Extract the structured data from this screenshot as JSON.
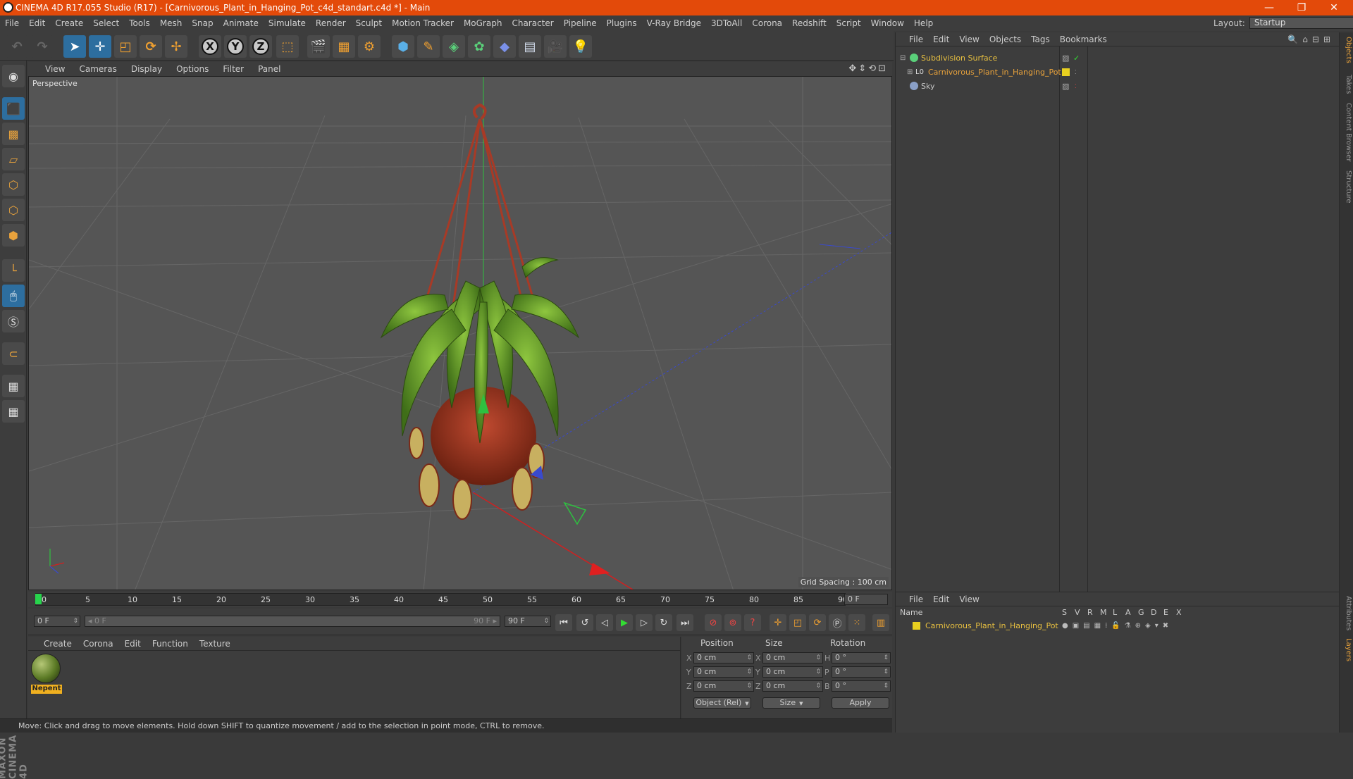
{
  "window": {
    "title": "CINEMA 4D R17.055 Studio (R17) - [Carnivorous_Plant_in_Hanging_Pot_c4d_standart.c4d *] - Main",
    "controls": [
      "—",
      "❐",
      "✕"
    ]
  },
  "menubar": {
    "items": [
      "File",
      "Edit",
      "Create",
      "Select",
      "Tools",
      "Mesh",
      "Snap",
      "Animate",
      "Simulate",
      "Render",
      "Sculpt",
      "Motion Tracker",
      "MoGraph",
      "Character",
      "Pipeline",
      "Plugins",
      "V-Ray Bridge",
      "3DToAll",
      "Corona",
      "Redshift",
      "Script",
      "Window",
      "Help"
    ],
    "layout_label": "Layout:",
    "layout_value": "Startup"
  },
  "toolbar": {
    "axis_x": "X",
    "axis_y": "Y",
    "axis_z": "Z"
  },
  "viewport": {
    "menu": [
      "View",
      "Cameras",
      "Display",
      "Options",
      "Filter",
      "Panel"
    ],
    "label": "Perspective",
    "grid_spacing": "Grid Spacing : 100 cm",
    "nav_icons": "✥⇕⟲⊡"
  },
  "timeline": {
    "ticks": [
      "0",
      "5",
      "10",
      "15",
      "20",
      "25",
      "30",
      "35",
      "40",
      "45",
      "50",
      "55",
      "60",
      "65",
      "70",
      "75",
      "80",
      "85",
      "90"
    ],
    "current_frame": "0 F"
  },
  "transport": {
    "start_frame": "0 F",
    "range_start": "◂ 0 F",
    "range_end": "90 F ▸",
    "end_frame": "90 F"
  },
  "material_panel": {
    "menu": [
      "Create",
      "Corona",
      "Edit",
      "Function",
      "Texture"
    ],
    "material_name": "Nepent"
  },
  "coordinates": {
    "headers": [
      "Position",
      "Size",
      "Rotation"
    ],
    "rows": [
      {
        "axis": "X",
        "pos": "0 cm",
        "size_axis": "X",
        "size": "0 cm",
        "rot_axis": "H",
        "rot": "0 °"
      },
      {
        "axis": "Y",
        "pos": "0 cm",
        "size_axis": "Y",
        "size": "0 cm",
        "rot_axis": "P",
        "rot": "0 °"
      },
      {
        "axis": "Z",
        "pos": "0 cm",
        "size_axis": "Z",
        "size": "0 cm",
        "rot_axis": "B",
        "rot": "0 °"
      }
    ],
    "mode_dropdown": "Object (Rel)",
    "size_dropdown": "Size",
    "apply": "Apply"
  },
  "status": "Move: Click and drag to move elements. Hold down SHIFT to quantize movement / add to the selection in point mode, CTRL to remove.",
  "objects_panel": {
    "menu": [
      "File",
      "Edit",
      "View",
      "Objects",
      "Tags",
      "Bookmarks"
    ],
    "items": [
      {
        "name": "Subdivision Surface",
        "color": "#e8c040"
      },
      {
        "name": "Carnivorous_Plant_in_Hanging_Pot",
        "color": "#e8a23c"
      },
      {
        "name": "Sky",
        "color": "#c8c8c8"
      }
    ]
  },
  "layers_panel": {
    "menu": [
      "File",
      "Edit",
      "View"
    ],
    "columns": [
      "Name",
      "S",
      "V",
      "R",
      "M",
      "L",
      "A",
      "G",
      "D",
      "E",
      "X"
    ],
    "layer_name": "Carnivorous_Plant_in_Hanging_Pot"
  },
  "side_tabs": [
    "Objects",
    "Takes",
    "Content Browser",
    "Structure",
    "Attributes",
    "Layers"
  ],
  "colors": {
    "accent": "#e34a0a",
    "selection_blue": "#2d6e9f",
    "layer_yellow": "#e8d020"
  }
}
